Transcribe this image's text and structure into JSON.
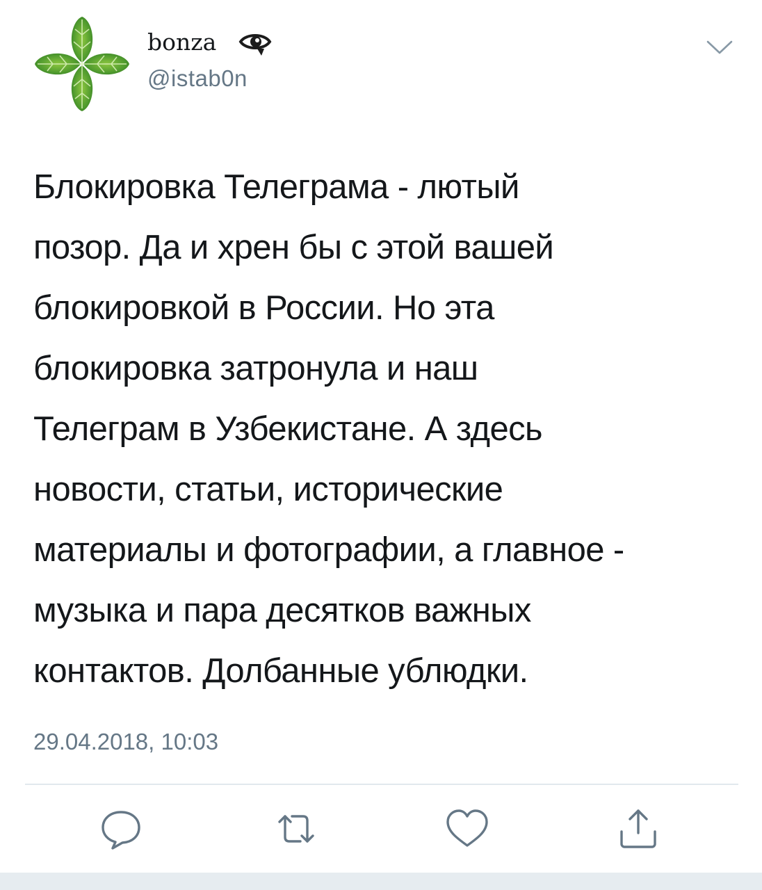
{
  "user": {
    "display_name": "bonza",
    "handle": "@istab0n",
    "avatar_icon": "four-leaf-clover-icon",
    "name_badge_icon": "eye-icon"
  },
  "tweet": {
    "lines": [
      "Блокировка Телеграма - лютый",
      "позор. Да и хрен бы с этой вашей",
      "блокировкой в России. Но эта",
      "блокировка затронула и наш",
      "Телеграм в Узбекистане. А здесь",
      "новости, статьи, исторические",
      "материалы и фотографии, а главное -",
      "музыка и пара десятков важных",
      "контактов. Долбанные ублюдки."
    ],
    "timestamp": "29.04.2018, 10:03"
  },
  "actions": [
    {
      "name": "reply-button",
      "icon": "speech-bubble-icon"
    },
    {
      "name": "retweet-button",
      "icon": "retweet-arrows-icon"
    },
    {
      "name": "like-button",
      "icon": "heart-icon"
    },
    {
      "name": "share-button",
      "icon": "share-icon"
    }
  ],
  "colors": {
    "text": "#14171a",
    "secondary": "#657786",
    "icon": "#657786",
    "divider": "#e1e8ed",
    "clover_green": "#4f9a2e"
  }
}
